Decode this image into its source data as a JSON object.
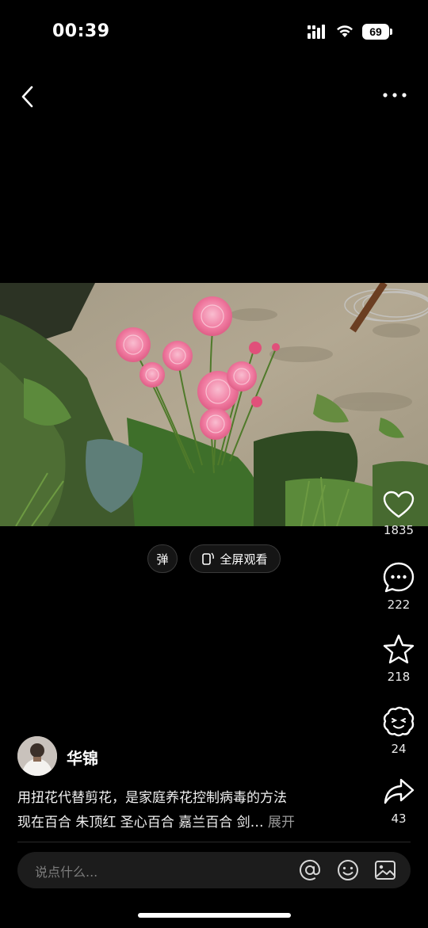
{
  "status_bar": {
    "time": "00:39",
    "battery": "69"
  },
  "nav": {
    "back_icon": "chevron-left-icon",
    "more_icon": "more-horizontal-icon"
  },
  "video": {
    "subject": "pink ranunculus flowers in garden"
  },
  "chips": {
    "danmu": "弹",
    "fullscreen": "全屏观看"
  },
  "actions": {
    "like_count": "1835",
    "comment_count": "222",
    "favorite_count": "218",
    "tip_count": "24",
    "share_count": "43"
  },
  "author": {
    "name": "华锦"
  },
  "caption": {
    "line1": "用扭花代替剪花，是家庭养花控制病毒的方法",
    "line2": "现在百合 朱顶红 圣心百合 嘉兰百合 剑…",
    "expand": "展开"
  },
  "comment_bar": {
    "placeholder": "说点什么..."
  },
  "colors": {
    "background": "#000000",
    "flower_pink": "#f07aa0",
    "muted_text": "#7d7d7d"
  }
}
